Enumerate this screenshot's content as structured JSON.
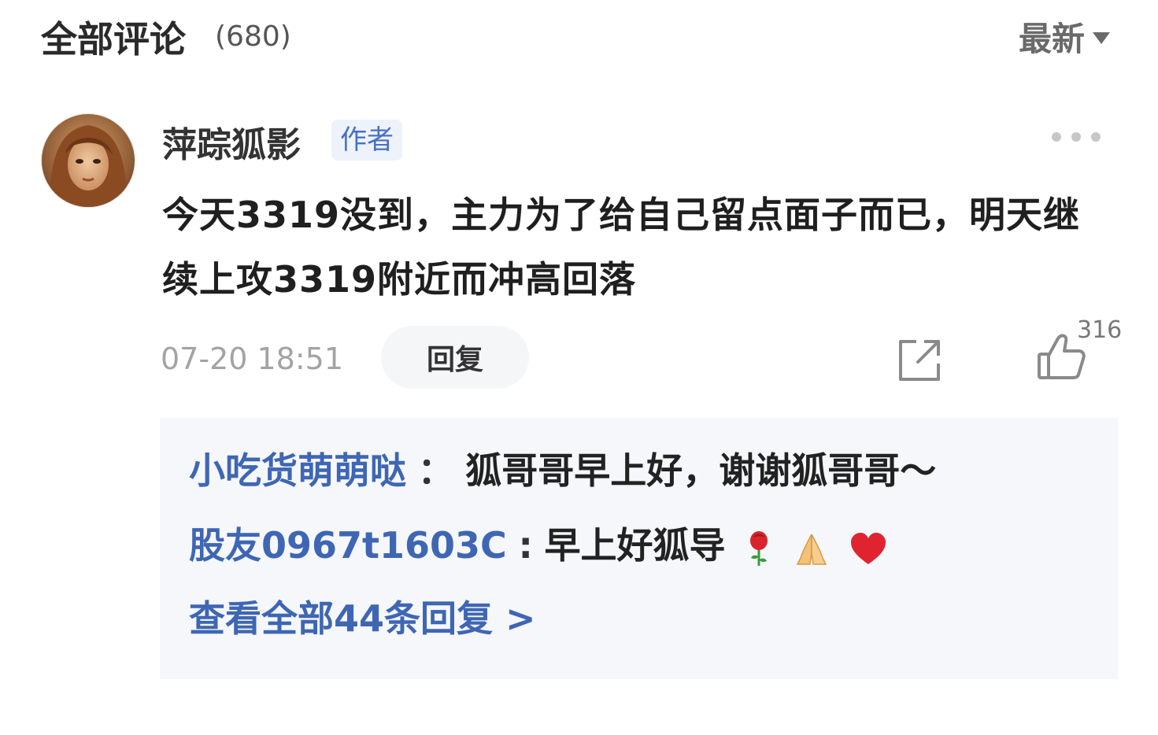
{
  "header": {
    "title": "全部评论",
    "count": "(680)",
    "sort_label": "最新"
  },
  "comment": {
    "author": "萍踪狐影",
    "author_tag": "作者",
    "text": "今天3319没到，主力为了给自己留点面子而已，明天继续上攻3319附近而冲高回落",
    "timestamp": "07-20 18:51",
    "reply_label": "回复",
    "like_count": "316",
    "icons": [
      "more-icon",
      "share-icon",
      "thumbs-up-icon"
    ]
  },
  "replies": {
    "items": [
      {
        "user": "小吃货萌萌哒",
        "separator": "：",
        "text": "狐哥哥早上好，谢谢狐哥哥～",
        "emojis": []
      },
      {
        "user": "股友0967t1603C",
        "separator": ":",
        "text": "早上好狐导",
        "emojis": [
          "rose-emoji",
          "folded-hands-emoji",
          "red-heart-emoji"
        ]
      }
    ],
    "view_all_label": "查看全部44条回复 >"
  },
  "colors": {
    "link_blue": "#3e66b4",
    "tag_bg": "#edf2fb",
    "reply_box_bg": "#f5f7fa",
    "like_color": "#888888"
  }
}
